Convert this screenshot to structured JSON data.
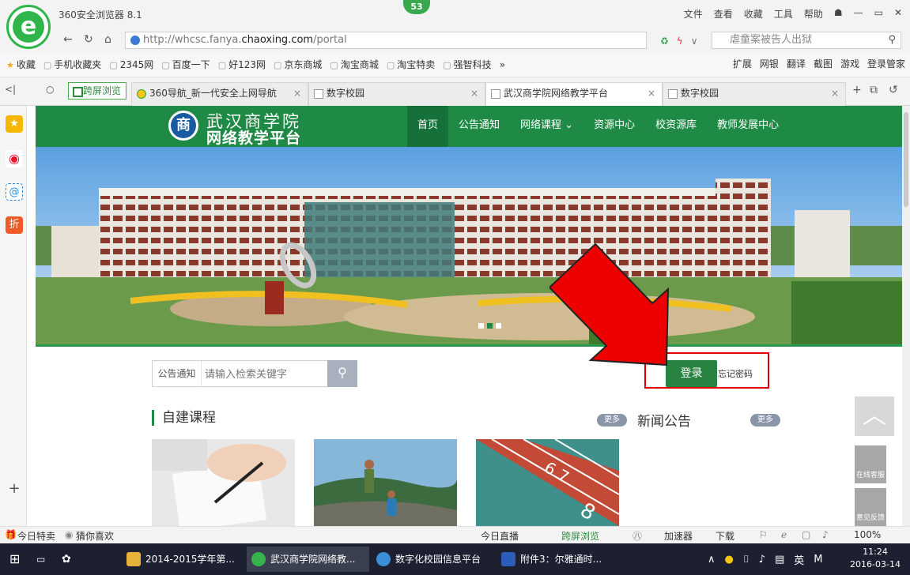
{
  "browser": {
    "app_title": "360安全浏览器 8.1",
    "badge_count": "53",
    "top_menu": [
      "文件",
      "查看",
      "收藏",
      "工具",
      "帮助"
    ],
    "url_pre": "http://whcsc.fanya.",
    "url_domain": "chaoxing.com",
    "url_post": "/portal",
    "search_text": "虐童案被告人出狱",
    "favorites": [
      "收藏",
      "手机收藏夹",
      "2345网",
      "百度一下",
      "好123网",
      "京东商城",
      "淘宝商城",
      "淘宝特卖",
      "强智科技"
    ],
    "fav_overflow": "»",
    "fav_right": [
      "扩展",
      "网银",
      "翻译",
      "截图",
      "游戏",
      "登录管家"
    ],
    "cross_screen": "跨屏浏览",
    "tabs": [
      {
        "label": "360导航_新一代安全上网导航"
      },
      {
        "label": "数字校园"
      },
      {
        "label": "武汉商学院网络教学平台"
      },
      {
        "label": "数字校园"
      }
    ]
  },
  "site": {
    "name_line1": "武汉商学院",
    "name_line2": "网络教学平台",
    "emblem_char": "商",
    "nav": [
      "首页",
      "公告通知",
      "网络课程 ⌄",
      "资源中心",
      "校资源库",
      "教师发展中心"
    ],
    "search_category": "公告通知",
    "search_placeholder": "请输入检索关键字",
    "login_label": "登录",
    "forgot_label": "忘记密码",
    "section1_title": "自建课程",
    "more_label": "更多",
    "section2_title": "新闻公告",
    "float_cs": "在线客服",
    "float_fb": "意见反馈"
  },
  "statusbar": {
    "left1": "今日特卖",
    "left2": "猜你喜欢",
    "live": "今日直播",
    "cross": "跨屏浏览",
    "accelerator": "加速器",
    "download": "下载",
    "zoom": "100%"
  },
  "taskbar": {
    "tasks": [
      "2014-2015学年第...",
      "武汉商学院网络教...",
      "数字化校园信息平台",
      "附件3：尔雅通时..."
    ],
    "ime": "英",
    "time": "11:24",
    "date": "2016-03-14"
  },
  "colors": {
    "site_green": "#1f8a46",
    "login_green": "#27833f",
    "highlight_red": "#e00000",
    "arrow_red": "#ee0000"
  }
}
